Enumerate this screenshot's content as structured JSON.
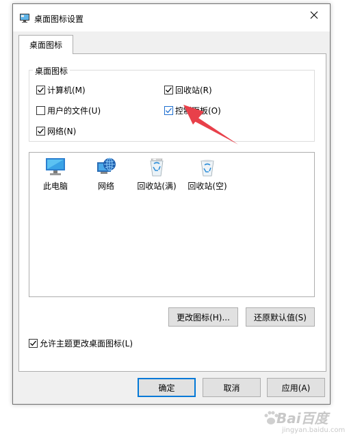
{
  "window": {
    "title": "桌面图标设置"
  },
  "tabs": [
    {
      "label": "桌面图标",
      "active": true
    }
  ],
  "group": {
    "legend": "桌面图标",
    "checkboxes": [
      {
        "label": "计算机(M)",
        "checked": true
      },
      {
        "label": "回收站(R)",
        "checked": true
      },
      {
        "label": "用户的文件(U)",
        "checked": false
      },
      {
        "label": "控制面板(O)",
        "checked": true
      },
      {
        "label": "网络(N)",
        "checked": true
      }
    ]
  },
  "icon_list": [
    {
      "label": "此电脑",
      "icon": "computer-icon"
    },
    {
      "label": "网络",
      "icon": "network-globe-icon"
    },
    {
      "label": "回收站(满)",
      "icon": "recycle-bin-full-icon"
    },
    {
      "label": "回收站(空)",
      "icon": "recycle-bin-empty-icon"
    }
  ],
  "buttons": {
    "change_icon": "更改图标(H)...",
    "restore_default": "还原默认值(S)",
    "ok": "确定",
    "cancel": "取消",
    "apply": "应用(A)"
  },
  "allow_themes": {
    "label": "允许主题更改桌面图标(L)",
    "checked": true
  },
  "watermark": {
    "brand": "Bai百度",
    "url": "jingyan.baidu.com"
  },
  "colors": {
    "arrow": "#e8404a",
    "focus": "#0078d7"
  }
}
